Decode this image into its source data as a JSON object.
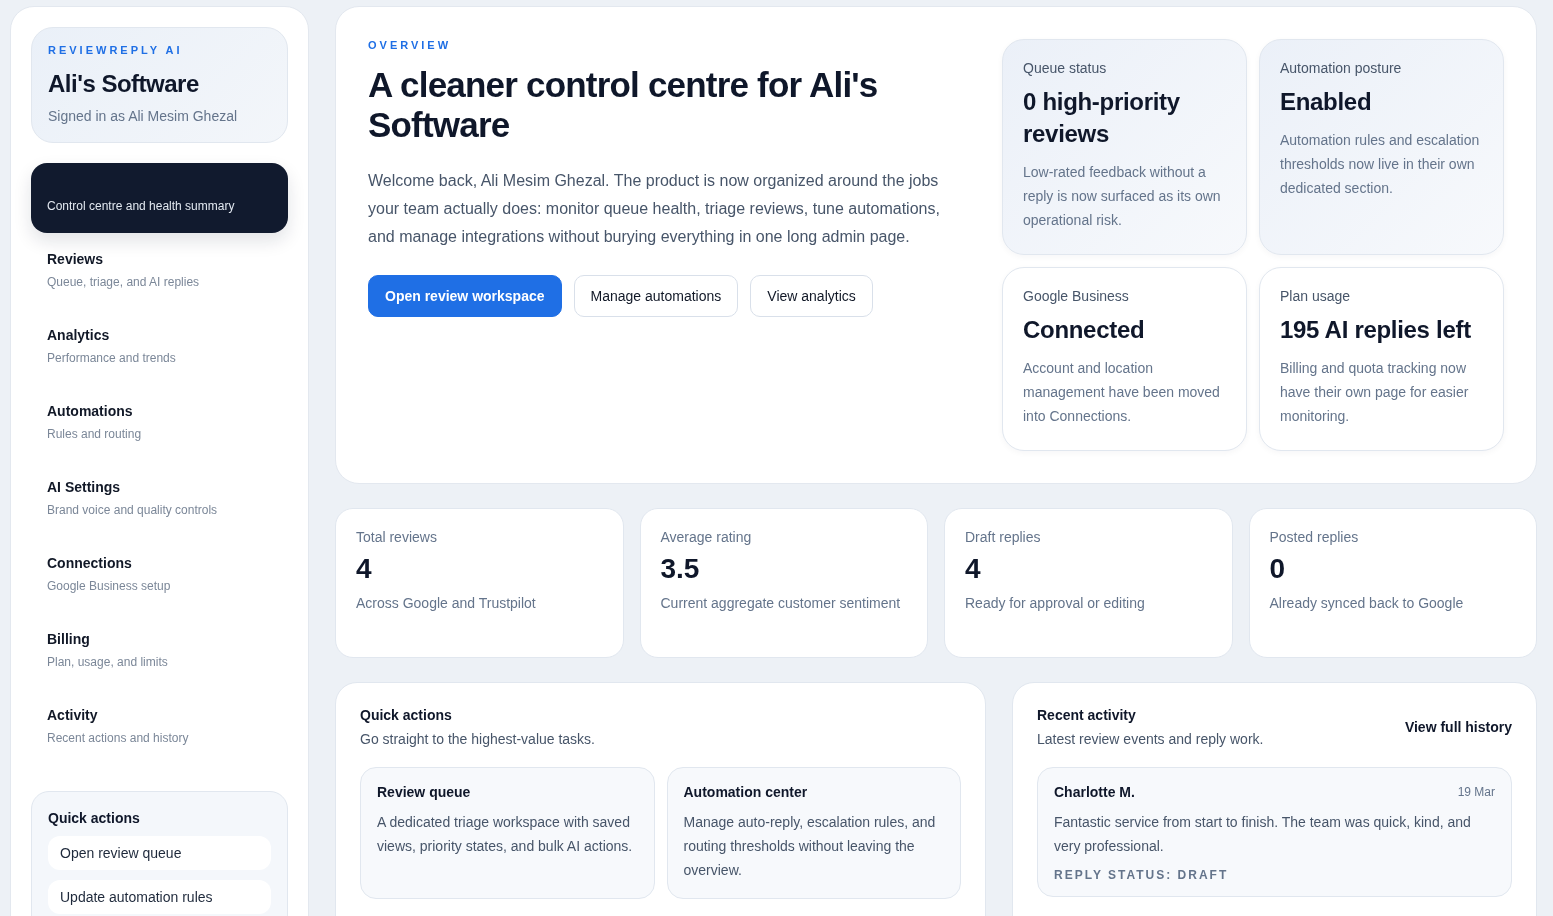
{
  "sidebar": {
    "brand": {
      "eyebrow": "REVIEWREPLY AI",
      "title": "Ali's Software",
      "subtitle": "Signed in as Ali Mesim Ghezal"
    },
    "nav_items": [
      {
        "description": "Control centre and health summary",
        "selected": true
      },
      {
        "label": "Reviews",
        "description": "Queue, triage, and AI replies",
        "selected": false
      },
      {
        "label": "Analytics",
        "description": "Performance and trends",
        "selected": false
      },
      {
        "label": "Automations",
        "description": "Rules and routing",
        "selected": false
      },
      {
        "label": "AI Settings",
        "description": "Brand voice and quality controls",
        "selected": false
      },
      {
        "label": "Connections",
        "description": "Google Business setup",
        "selected": false
      },
      {
        "label": "Billing",
        "description": "Plan, usage, and limits",
        "selected": false
      },
      {
        "label": "Activity",
        "description": "Recent actions and history",
        "selected": false
      }
    ],
    "quick_actions": {
      "title": "Quick actions",
      "items": [
        "Open review queue",
        "Update automation rules"
      ]
    }
  },
  "hero": {
    "eyebrow": "OVERVIEW",
    "title": "A cleaner control centre for Ali's Software",
    "intro": "Welcome back, Ali Mesim Ghezal. The product is now organized around the jobs your team actually does: monitor queue health, triage reviews, tune automations, and manage integrations without burying everything in one long admin page.",
    "buttons": [
      {
        "label": "Open review workspace",
        "kind": "primary"
      },
      {
        "label": "Manage automations",
        "kind": "secondary"
      },
      {
        "label": "View analytics",
        "kind": "secondary"
      }
    ],
    "tiles": [
      {
        "label": "Queue status",
        "value": "0 high-priority reviews",
        "note": "Low-rated feedback without a reply is now surfaced as its own operational risk.",
        "highlighted": true
      },
      {
        "label": "Automation posture",
        "value": "Enabled",
        "note": "Automation rules and escalation thresholds now live in their own dedicated section.",
        "highlighted": true
      },
      {
        "label": "Google Business",
        "value": "Connected",
        "note": "Account and location management have been moved into Connections.",
        "highlighted": false
      },
      {
        "label": "Plan usage",
        "value": "195 AI replies left",
        "note": "Billing and quota tracking now have their own page for easier monitoring.",
        "highlighted": false
      }
    ]
  },
  "stats": [
    {
      "label": "Total reviews",
      "value": "4",
      "note": "Across Google and Trustpilot"
    },
    {
      "label": "Average rating",
      "value": "3.5",
      "note": "Current aggregate customer sentiment"
    },
    {
      "label": "Draft replies",
      "value": "4",
      "note": "Ready for approval or editing"
    },
    {
      "label": "Posted replies",
      "value": "0",
      "note": "Already synced back to Google"
    }
  ],
  "quick_actions": {
    "title": "Quick actions",
    "subtitle": "Go straight to the highest-value tasks.",
    "cards": [
      {
        "title": "Review queue",
        "description": "A dedicated triage workspace with saved views, priority states, and bulk AI actions."
      },
      {
        "title": "Automation center",
        "description": "Manage auto-reply, escalation rules, and routing thresholds without leaving the overview."
      }
    ]
  },
  "recent_activity": {
    "title": "Recent activity",
    "subtitle": "Latest review events and reply work.",
    "link": "View full history",
    "events": [
      {
        "author": "Charlotte M.",
        "date": "19 Mar",
        "text": "Fantastic service from start to finish. The team was quick, kind, and very professional.",
        "status": "REPLY STATUS: DRAFT"
      }
    ]
  }
}
